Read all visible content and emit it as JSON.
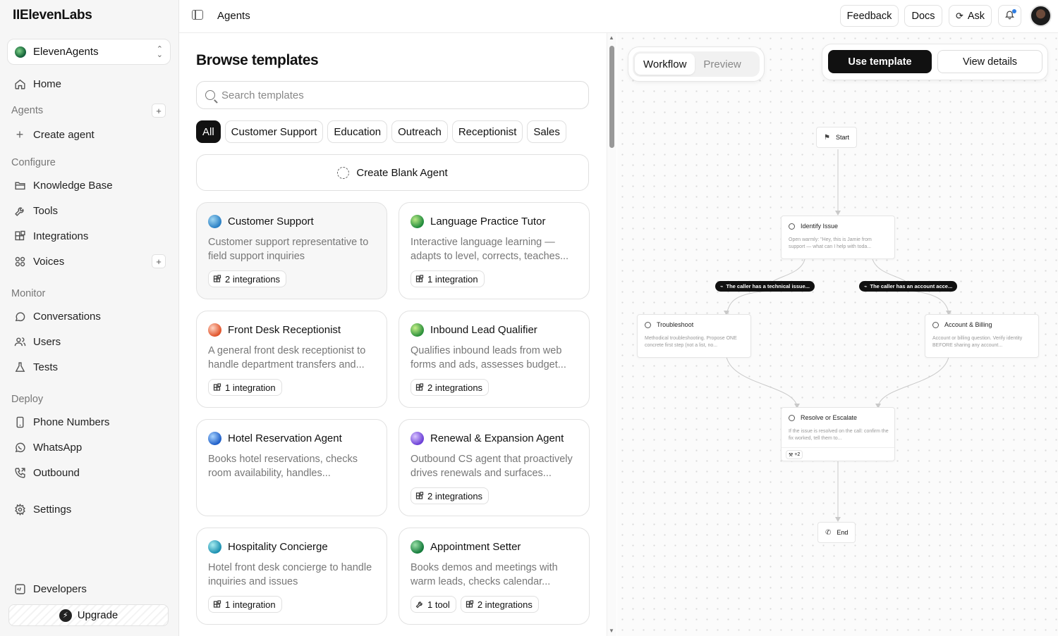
{
  "app": {
    "logo": "IIElevenLabs",
    "workspace": "ElevenAgents",
    "page_title": "Agents"
  },
  "sidebar": {
    "home": "Home",
    "agents_section": "Agents",
    "create_agent": "Create agent",
    "configure_section": "Configure",
    "knowledge_base": "Knowledge Base",
    "tools": "Tools",
    "integrations": "Integrations",
    "voices": "Voices",
    "monitor_section": "Monitor",
    "conversations": "Conversations",
    "users": "Users",
    "tests": "Tests",
    "deploy_section": "Deploy",
    "phone_numbers": "Phone Numbers",
    "whatsapp": "WhatsApp",
    "outbound": "Outbound",
    "settings": "Settings",
    "developers": "Developers",
    "upgrade": "Upgrade"
  },
  "topbar": {
    "feedback": "Feedback",
    "docs": "Docs",
    "ask": "Ask"
  },
  "browse": {
    "heading": "Browse templates",
    "search_placeholder": "Search templates",
    "filters": [
      "All",
      "Customer Support",
      "Education",
      "Outreach",
      "Receptionist",
      "Sales"
    ],
    "create_blank": "Create Blank Agent"
  },
  "templates": [
    {
      "title": "Customer Support",
      "desc": "Customer support representative to field support inquiries",
      "tags": [
        "2 integrations"
      ],
      "orb": [
        "#9fd6f2",
        "#2a7fc4"
      ]
    },
    {
      "title": "Language Practice Tutor",
      "desc": "Interactive language learning — adapts to level, corrects, teaches...",
      "tags": [
        "1 integration"
      ],
      "orb": [
        "#b8e986",
        "#1f8a3b"
      ]
    },
    {
      "title": "Front Desk Receptionist",
      "desc": "A general front desk receptionist to handle department transfers and...",
      "tags": [
        "1 integration"
      ],
      "orb": [
        "#ffd3c2",
        "#e0532a"
      ]
    },
    {
      "title": "Inbound Lead Qualifier",
      "desc": "Qualifies inbound leads from web forms and ads, assesses budget...",
      "tags": [
        "2 integrations"
      ],
      "orb": [
        "#c6f08a",
        "#2a8f3a"
      ]
    },
    {
      "title": "Hotel Reservation Agent",
      "desc": "Books hotel reservations, checks room availability, handles...",
      "tags": [],
      "orb": [
        "#a8d4ff",
        "#1e5ec8"
      ]
    },
    {
      "title": "Renewal & Expansion Agent",
      "desc": "Outbound CS agent that proactively drives renewals and surfaces...",
      "tags": [
        "2 integrations"
      ],
      "orb": [
        "#d9c4ff",
        "#6b3fd6"
      ]
    },
    {
      "title": "Hospitality Concierge",
      "desc": "Hotel front desk concierge to handle inquiries and issues",
      "tags": [
        "1 integration"
      ],
      "orb": [
        "#a7ecf0",
        "#1a8fb0"
      ]
    },
    {
      "title": "Appointment Setter",
      "desc": "Books demos and meetings with warm leads, checks calendar...",
      "tags": [
        "1 tool",
        "2 integrations"
      ],
      "orb": [
        "#9be0a8",
        "#137a3a"
      ]
    }
  ],
  "workflow": {
    "tabs": [
      "Workflow",
      "Preview"
    ],
    "use_template": "Use template",
    "view_details": "View details",
    "start": "Start",
    "end": "End",
    "identify": {
      "title": "Identify Issue",
      "desc": "Open warmly: \"Hey, this is Jamie from support — what can I help with toda..."
    },
    "pill_left": "The caller has a technical issue...",
    "pill_right": "The caller has an account acce...",
    "troubleshoot": {
      "title": "Troubleshoot",
      "desc": "Methodical troubleshooting. Propose ONE concrete first step (not a list, no..."
    },
    "billing": {
      "title": "Account & Billing",
      "desc": "Account or billing question. Verify identity BEFORE sharing any account..."
    },
    "resolve": {
      "title": "Resolve or Escalate",
      "desc": "If the issue is resolved on the call: confirm the fix worked, tell them to...",
      "badge": "+2"
    }
  }
}
